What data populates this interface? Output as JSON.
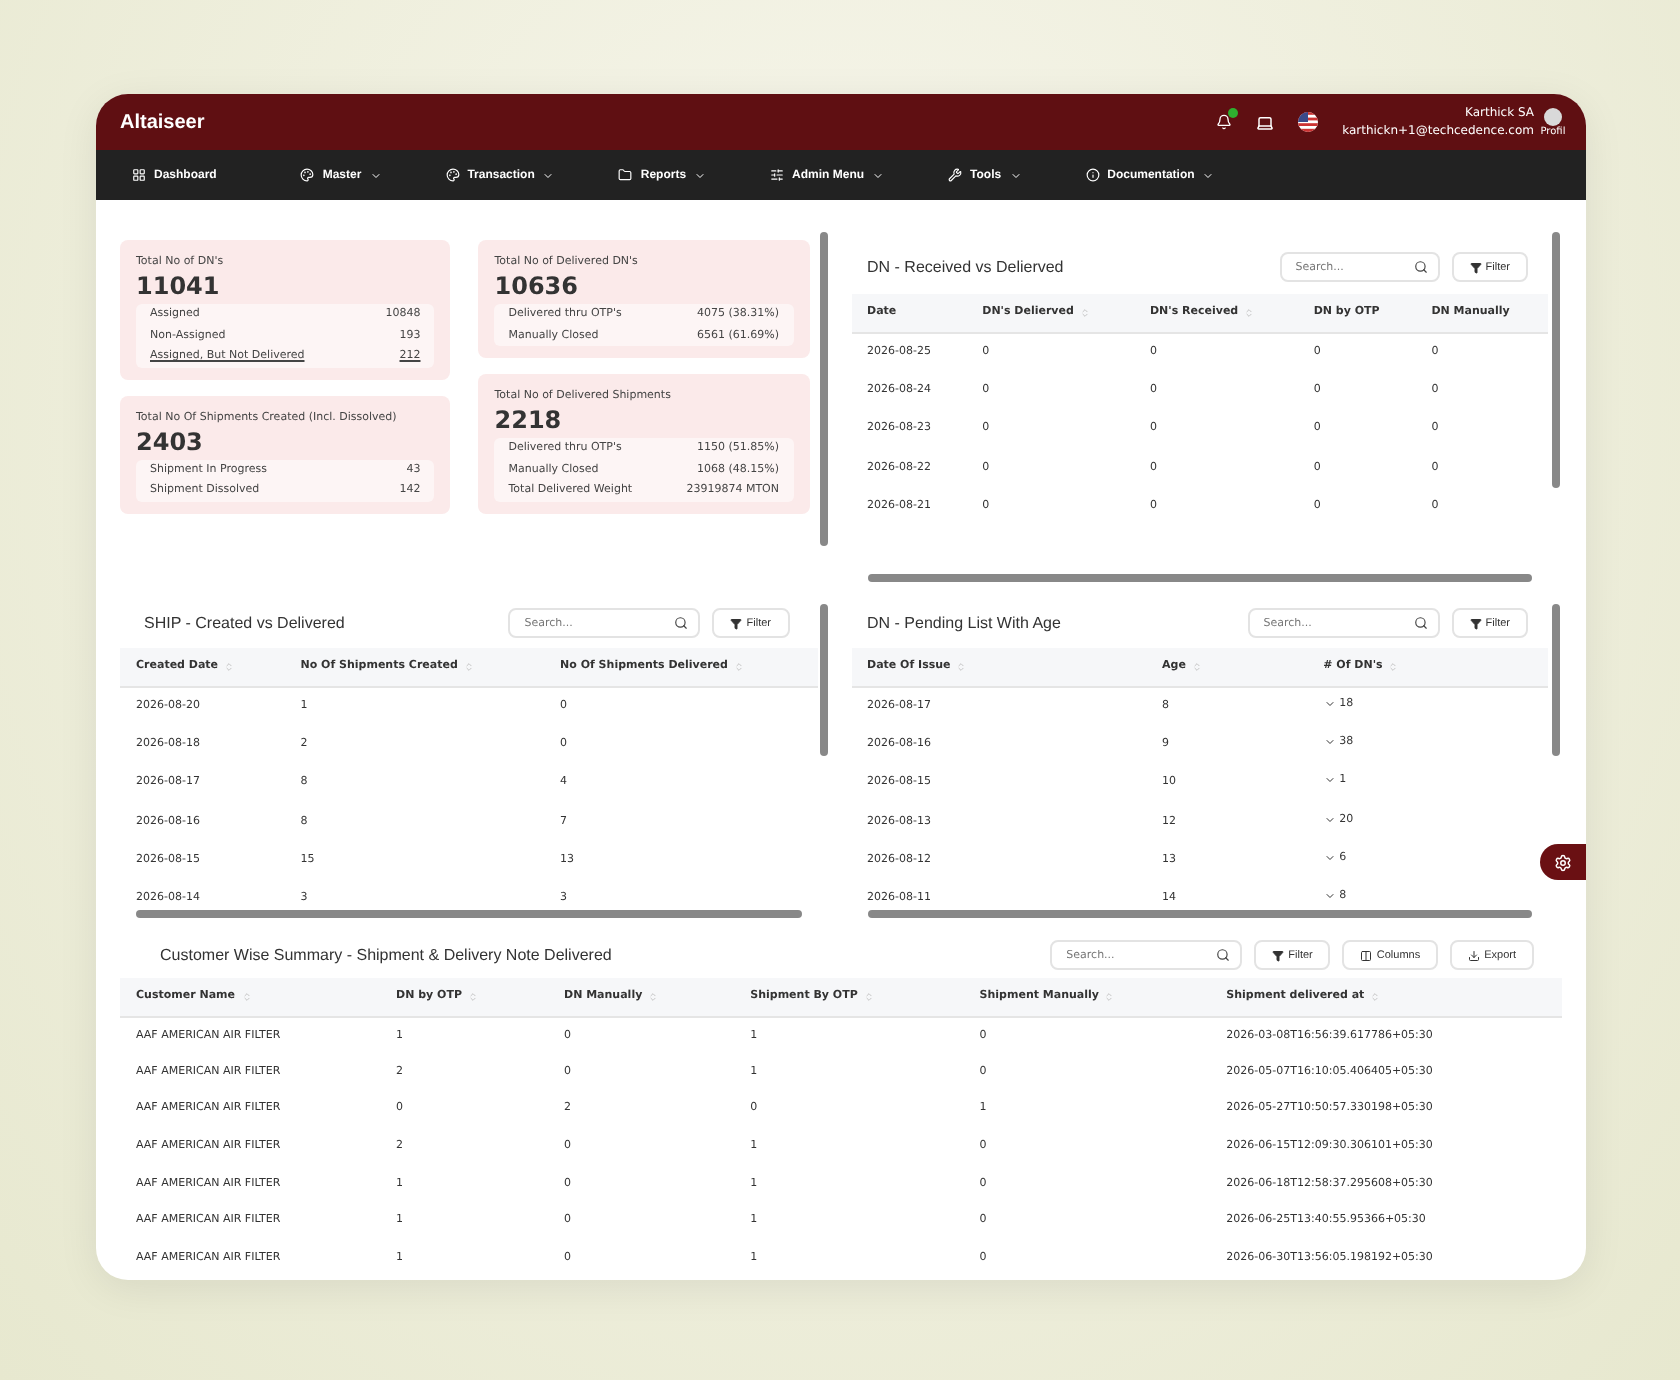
{
  "header": {
    "logo": "Altaiseer",
    "notification_dot": true,
    "user_name": "Karthick SA",
    "user_email": "karthickn+1@techcedence.com",
    "avatar_alt": "Profil"
  },
  "nav": [
    {
      "label": "Dashboard",
      "has_menu": false
    },
    {
      "label": "Master",
      "has_menu": true
    },
    {
      "label": "Transaction",
      "has_menu": true
    },
    {
      "label": "Reports",
      "has_menu": true
    },
    {
      "label": "Admin Menu",
      "has_menu": true
    },
    {
      "label": "Tools",
      "has_menu": true
    },
    {
      "label": "Documentation",
      "has_menu": true
    }
  ],
  "summary_cards": [
    {
      "title": "Total No of DN's",
      "value": "11041",
      "rows": [
        {
          "label": "Assigned",
          "value": "10848",
          "kind": "text"
        },
        {
          "label": "Non-Assigned",
          "value": "193",
          "kind": "text"
        },
        {
          "label": "Assigned, But Not Delivered",
          "value": "212",
          "kind": "link"
        }
      ]
    },
    {
      "title": "Total No Of Shipments Created (Incl. Dissolved)",
      "value": "2403",
      "rows": [
        {
          "label": "Shipment In Progress",
          "value": "43",
          "kind": "text"
        },
        {
          "label": "Shipment Dissolved",
          "value": "142",
          "kind": "text"
        }
      ]
    },
    {
      "title": "Total No of Delivered DN's",
      "value": "10636",
      "rows": [
        {
          "label": "Delivered thru OTP's",
          "value": "4075 (38.31%)",
          "kind": "text"
        },
        {
          "label": "Manually Closed",
          "value": "6561 (61.69%)",
          "kind": "text"
        }
      ]
    },
    {
      "title": "Total No of Delivered Shipments",
      "value": "2218",
      "rows": [
        {
          "label": "Delivered thru OTP's",
          "value": "1150 (51.85%)",
          "kind": "text"
        },
        {
          "label": "Manually Closed",
          "value": "1068 (48.15%)",
          "kind": "text"
        },
        {
          "label": "Total Delivered Weight",
          "value": "23919874 MTON",
          "kind": "text"
        }
      ]
    }
  ],
  "dn_received": {
    "title": "DN - Received vs Delierved",
    "search_placeholder": "Search...",
    "buttons": [
      "Filter"
    ],
    "columns": [
      {
        "label": "Date",
        "sortable": false,
        "kind": "text"
      },
      {
        "label": "DN's Delierved",
        "sortable": true,
        "kind": "text"
      },
      {
        "label": "DN's Received",
        "sortable": true,
        "kind": "text"
      },
      {
        "label": "DN by OTP",
        "sortable": false,
        "kind": "text"
      },
      {
        "label": "DN Manually",
        "sortable": false,
        "kind": "text"
      }
    ],
    "rows": [
      [
        "2026-08-25",
        "0",
        "0",
        "0",
        "0"
      ],
      [
        "2026-08-24",
        "0",
        "0",
        "0",
        "0"
      ],
      [
        "2026-08-23",
        "0",
        "0",
        "0",
        "0"
      ],
      [
        "2026-08-22",
        "0",
        "0",
        "0",
        "0"
      ],
      [
        "2026-08-21",
        "0",
        "0",
        "0",
        "0"
      ]
    ]
  },
  "ship": {
    "title": "SHIP - Created vs Delivered",
    "search_placeholder": "Search...",
    "buttons": [
      "Filter"
    ],
    "columns": [
      {
        "label": "Created Date",
        "sortable": true,
        "kind": "text"
      },
      {
        "label": "No Of Shipments Created",
        "sortable": true,
        "kind": "text"
      },
      {
        "label": "No Of Shipments Delivered",
        "sortable": true,
        "kind": "text"
      }
    ],
    "rows": [
      [
        "2026-08-20",
        "1",
        "0"
      ],
      [
        "2026-08-18",
        "2",
        "0"
      ],
      [
        "2026-08-17",
        "8",
        "4"
      ],
      [
        "2026-08-16",
        "8",
        "7"
      ],
      [
        "2026-08-15",
        "15",
        "13"
      ],
      [
        "2026-08-14",
        "3",
        "3"
      ]
    ]
  },
  "dn_pending": {
    "title": "DN - Pending List With Age",
    "search_placeholder": "Search...",
    "buttons": [
      "Filter"
    ],
    "columns": [
      {
        "label": "Date Of Issue",
        "sortable": true,
        "kind": "text"
      },
      {
        "label": "Age",
        "sortable": true,
        "kind": "text"
      },
      {
        "label": "# Of DN's",
        "sortable": true,
        "kind": "expandable"
      }
    ],
    "rows": [
      [
        "2026-08-17",
        "8",
        "18"
      ],
      [
        "2026-08-16",
        "9",
        "38"
      ],
      [
        "2026-08-15",
        "10",
        "1"
      ],
      [
        "2026-08-13",
        "12",
        "20"
      ],
      [
        "2026-08-12",
        "13",
        "6"
      ],
      [
        "2026-08-11",
        "14",
        "8"
      ]
    ]
  },
  "customer_summary": {
    "title": "Customer Wise Summary - Shipment & Delivery Note Delivered",
    "search_placeholder": "Search...",
    "buttons": [
      "Filter",
      "Columns",
      "Export"
    ],
    "columns": [
      {
        "label": "Customer Name",
        "sortable": true,
        "kind": "text"
      },
      {
        "label": "DN by OTP",
        "sortable": true,
        "kind": "text"
      },
      {
        "label": "DN Manually",
        "sortable": true,
        "kind": "text"
      },
      {
        "label": "Shipment By OTP",
        "sortable": true,
        "kind": "text"
      },
      {
        "label": "Shipment Manually",
        "sortable": true,
        "kind": "text"
      },
      {
        "label": "Shipment delivered at",
        "sortable": true,
        "kind": "text"
      }
    ],
    "rows": [
      [
        "AAF AMERICAN AIR FILTER",
        "1",
        "0",
        "1",
        "0",
        "2026-03-08T16:56:39.617786+05:30"
      ],
      [
        "AAF AMERICAN AIR FILTER",
        "2",
        "0",
        "1",
        "0",
        "2026-05-07T16:10:05.406405+05:30"
      ],
      [
        "AAF AMERICAN AIR FILTER",
        "0",
        "2",
        "0",
        "1",
        "2026-05-27T10:50:57.330198+05:30"
      ],
      [
        "AAF AMERICAN AIR FILTER",
        "2",
        "0",
        "1",
        "0",
        "2026-06-15T12:09:30.306101+05:30"
      ],
      [
        "AAF AMERICAN AIR FILTER",
        "1",
        "0",
        "1",
        "0",
        "2026-06-18T12:58:37.295608+05:30"
      ],
      [
        "AAF AMERICAN AIR FILTER",
        "1",
        "0",
        "1",
        "0",
        "2026-06-25T13:40:55.95366+05:30"
      ],
      [
        "AAF AMERICAN AIR FILTER",
        "1",
        "0",
        "1",
        "0",
        "2026-06-30T13:56:05.198192+05:30"
      ]
    ]
  }
}
